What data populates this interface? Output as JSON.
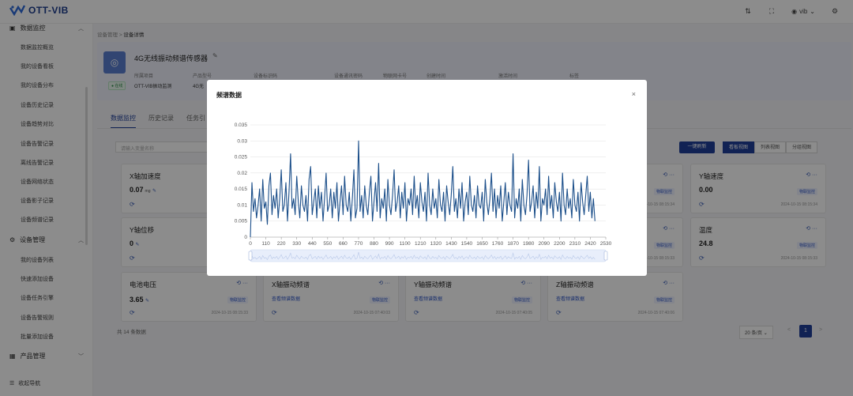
{
  "brand": {
    "name": "OTT-VIB",
    "sub": "·········"
  },
  "topbar": {
    "user": "vib"
  },
  "sidebar": {
    "groups": [
      {
        "label": "数据监控",
        "items": [
          "数据监控概览",
          "我的设备看板",
          "我的设备分布",
          "设备历史记录",
          "设备趋势对比",
          "设备告警记录",
          "离线告警记录",
          "设备网络状态",
          "设备影子记录",
          "设备频谱记录"
        ]
      },
      {
        "label": "设备管理",
        "items": [
          "我的设备列表",
          "快速添加设备",
          "设备任务引擎",
          "设备告警规则",
          "批量添加设备"
        ]
      },
      {
        "label": "产品管理",
        "items": []
      }
    ],
    "footer": "收起导航"
  },
  "breadcrumb": {
    "parent": "设备管理",
    "sep": ">",
    "current": "设备详情"
  },
  "device": {
    "name": "4G无线振动频谱传感器",
    "status": "在线",
    "labels": [
      "所属项目",
      "产品型号",
      "设备标识码",
      "设备通讯密码",
      "物联网卡号",
      "创建时间",
      "激活时间",
      "标签"
    ],
    "values": [
      "OTT-VIB振动监测",
      "4G无"
    ]
  },
  "tabs": [
    "数据监控",
    "历史记录",
    "任务引"
  ],
  "toolbar": {
    "search_placeholder": "请输入变量名称",
    "refresh": "一键刷新",
    "views": [
      "看板视图",
      "列表视图",
      "分组视图"
    ]
  },
  "cards": [
    {
      "title": "X轴加速度",
      "value": "0.07",
      "unit": "mg",
      "tag": "",
      "time": ""
    },
    {
      "title": "Y轴速度",
      "value": "0.00",
      "unit": "",
      "tag": "物联监控",
      "time": "2024-10-15 08:15:34"
    },
    {
      "title": "Y轴位移",
      "value": "0",
      "unit": "",
      "tag": "",
      "time": ""
    },
    {
      "title": "温度",
      "value": "24.8",
      "unit": "",
      "tag": "物联监控",
      "time": "2024-10-15 08:15:33"
    },
    {
      "title": "电池电压",
      "value": "3.65",
      "unit": "",
      "tag": "物联监控",
      "time": "2024-10-15 08:15:33"
    },
    {
      "title": "X轴振动频谱",
      "link": "查看频谱数据",
      "tag": "物联监控",
      "time": "2024-10-15 07:40:03"
    },
    {
      "title": "Y轴振动频谱",
      "link": "查看频谱数据",
      "tag": "物联监控",
      "time": "2024-10-15 07:40:05"
    },
    {
      "title": "Z轴振动频谱",
      "link": "查看频谱数据",
      "tag": "物联监控",
      "time": "2024-10-15 07:40:06"
    }
  ],
  "card_icons": "⟲ ···",
  "partial_times": [
    "2024-10-15 08:15:34",
    "2024-10-15 08:15:33"
  ],
  "partial_tag": "物联监控",
  "pagination": {
    "total": "共 14 条数据",
    "page_size": "20 条/页",
    "page": "1",
    "prev": "<",
    "next": ">"
  },
  "modal": {
    "title": "频谱数据",
    "close": "×"
  },
  "chart_data": {
    "type": "line",
    "title": "",
    "xlabel": "",
    "ylabel": "",
    "xlim": [
      0,
      2530
    ],
    "ylim": [
      0,
      0.035
    ],
    "yticks": [
      "0",
      "0.005",
      "0.01",
      "0.015",
      "0.02",
      "0.025",
      "0.03",
      "0.035"
    ],
    "xticks": [
      "0",
      "110",
      "220",
      "330",
      "440",
      "550",
      "660",
      "770",
      "880",
      "990",
      "1100",
      "1210",
      "1320",
      "1430",
      "1540",
      "1650",
      "1760",
      "1870",
      "1980",
      "2090",
      "2200",
      "2310",
      "2420",
      "2530"
    ],
    "line_color": "#1c4f8a",
    "grid": true,
    "datazoom": true,
    "x": [
      0,
      11,
      22,
      33,
      44,
      55,
      66,
      77,
      88,
      99,
      110,
      121,
      132,
      143,
      154,
      165,
      176,
      187,
      198,
      209,
      220,
      231,
      242,
      253,
      264,
      275,
      286,
      297,
      308,
      319,
      330,
      341,
      352,
      363,
      374,
      385,
      396,
      407,
      418,
      429,
      440,
      451,
      462,
      473,
      484,
      495,
      506,
      517,
      528,
      539,
      550,
      561,
      572,
      583,
      594,
      605,
      616,
      627,
      638,
      649,
      660,
      671,
      682,
      693,
      704,
      715,
      726,
      737,
      748,
      759,
      770,
      781,
      792,
      803,
      814,
      825,
      836,
      847,
      858,
      869,
      880,
      891,
      902,
      913,
      924,
      935,
      946,
      957,
      968,
      979,
      990,
      1001,
      1012,
      1023,
      1034,
      1045,
      1056,
      1067,
      1078,
      1089,
      1100,
      1111,
      1122,
      1133,
      1144,
      1155,
      1166,
      1177,
      1188,
      1199,
      1210,
      1221,
      1232,
      1243,
      1254,
      1265,
      1276,
      1287,
      1298,
      1309,
      1320,
      1331,
      1342,
      1353,
      1364,
      1375,
      1386,
      1397,
      1408,
      1419,
      1430,
      1441,
      1452,
      1463,
      1474,
      1485,
      1496,
      1507,
      1518,
      1529,
      1540,
      1551,
      1562,
      1573,
      1584,
      1595,
      1606,
      1617,
      1628,
      1639,
      1650,
      1661,
      1672,
      1683,
      1694,
      1705,
      1716,
      1727,
      1738,
      1749,
      1760,
      1771,
      1782,
      1793,
      1804,
      1815,
      1826,
      1837,
      1848,
      1859,
      1870,
      1881,
      1892,
      1903,
      1914,
      1925,
      1936,
      1947,
      1958,
      1969,
      1980,
      1991,
      2002,
      2013,
      2024,
      2035,
      2046,
      2057,
      2068,
      2079,
      2090,
      2101,
      2112,
      2123,
      2134,
      2145,
      2156,
      2167,
      2178,
      2189,
      2200,
      2211,
      2222,
      2233,
      2244,
      2255,
      2266,
      2277,
      2288,
      2299,
      2310,
      2321,
      2332,
      2343,
      2354,
      2365,
      2376,
      2387,
      2398,
      2409,
      2420,
      2431,
      2442,
      2453,
      2464,
      2475,
      2486,
      2497,
      2508,
      2519,
      2530
    ],
    "y": [
      0.0,
      0.017,
      0.008,
      0.012,
      0.006,
      0.01,
      0.015,
      0.005,
      0.018,
      0.009,
      0.011,
      0.004,
      0.016,
      0.02,
      0.007,
      0.013,
      0.009,
      0.015,
      0.006,
      0.012,
      0.021,
      0.008,
      0.01,
      0.017,
      0.005,
      0.014,
      0.026,
      0.009,
      0.012,
      0.007,
      0.019,
      0.011,
      0.006,
      0.016,
      0.01,
      0.008,
      0.013,
      0.005,
      0.018,
      0.022,
      0.007,
      0.011,
      0.015,
      0.006,
      0.016,
      0.009,
      0.014,
      0.005,
      0.012,
      0.02,
      0.008,
      0.01,
      0.015,
      0.006,
      0.014,
      0.009,
      0.017,
      0.005,
      0.011,
      0.016,
      0.007,
      0.019,
      0.01,
      0.008,
      0.014,
      0.005,
      0.012,
      0.021,
      0.006,
      0.009,
      0.03,
      0.008,
      0.013,
      0.006,
      0.016,
      0.01,
      0.007,
      0.014,
      0.019,
      0.005,
      0.011,
      0.017,
      0.008,
      0.023,
      0.006,
      0.012,
      0.009,
      0.015,
      0.005,
      0.018,
      0.01,
      0.007,
      0.013,
      0.021,
      0.008,
      0.011,
      0.016,
      0.006,
      0.014,
      0.009,
      0.017,
      0.005,
      0.012,
      0.01,
      0.015,
      0.007,
      0.019,
      0.009,
      0.013,
      0.006,
      0.017,
      0.011,
      0.008,
      0.014,
      0.005,
      0.02,
      0.01,
      0.007,
      0.015,
      0.009,
      0.012,
      0.006,
      0.018,
      0.01,
      0.008,
      0.014,
      0.005,
      0.016,
      0.011,
      0.007,
      0.013,
      0.022,
      0.008,
      0.012,
      0.006,
      0.015,
      0.009,
      0.017,
      0.005,
      0.011,
      0.014,
      0.007,
      0.019,
      0.01,
      0.008,
      0.013,
      0.006,
      0.016,
      0.01,
      0.009,
      0.014,
      0.005,
      0.018,
      0.011,
      0.007,
      0.012,
      0.02,
      0.008,
      0.015,
      0.006,
      0.013,
      0.009,
      0.016,
      0.005,
      0.011,
      0.017,
      0.007,
      0.014,
      0.01,
      0.008,
      0.026,
      0.006,
      0.012,
      0.009,
      0.015,
      0.005,
      0.018,
      0.01,
      0.007,
      0.013,
      0.024,
      0.008,
      0.011,
      0.016,
      0.006,
      0.014,
      0.009,
      0.022,
      0.005,
      0.012,
      0.01,
      0.015,
      0.007,
      0.019,
      0.009,
      0.013,
      0.006,
      0.017,
      0.011,
      0.008,
      0.014,
      0.005,
      0.02,
      0.01,
      0.007,
      0.015,
      0.009,
      0.012,
      0.006,
      0.018,
      0.01,
      0.008,
      0.014,
      0.005,
      0.017,
      0.011,
      0.007,
      0.013,
      0.019,
      0.008,
      0.014,
      0.006,
      0.012,
      0.005
    ]
  }
}
